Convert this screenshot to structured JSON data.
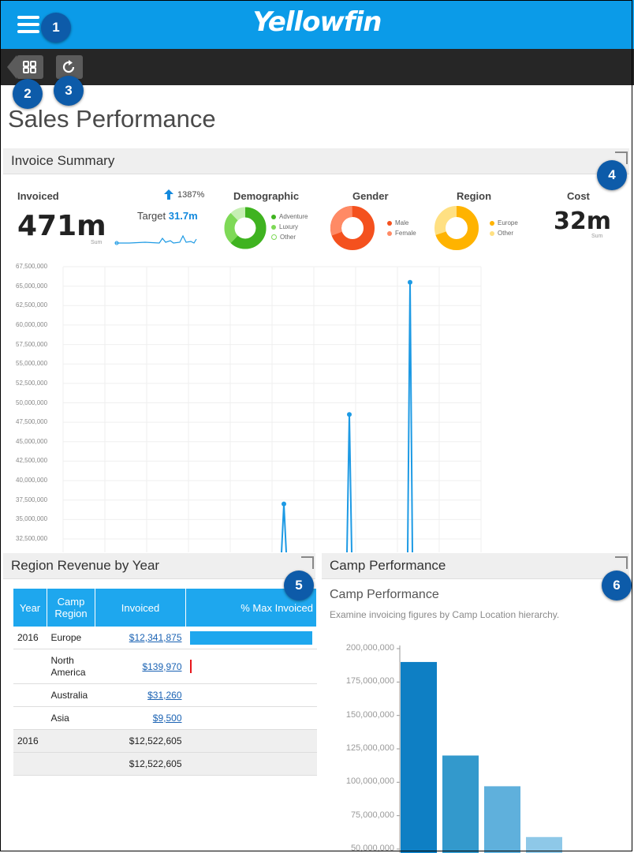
{
  "app": {
    "brand": "Yellowfin"
  },
  "page": {
    "title": "Sales Performance"
  },
  "badges": [
    "1",
    "2",
    "3",
    "4",
    "5",
    "6"
  ],
  "toolbar": {
    "grid_icon": "grid-icon",
    "refresh_icon": "refresh-icon"
  },
  "invoice_summary": {
    "header": "Invoice Summary",
    "invoiced": {
      "label": "Invoiced",
      "value": "471m",
      "sub": "Sum",
      "change": "1387%",
      "target_label": "Target",
      "target_value": "31.7m"
    },
    "demographic": {
      "label": "Demographic",
      "legend": [
        "Adventure",
        "Luxury",
        "Other"
      ],
      "colors": [
        "#3fb320",
        "#7ed957",
        "#c6efb3"
      ]
    },
    "gender": {
      "label": "Gender",
      "legend": [
        "Male",
        "Female"
      ],
      "colors": [
        "#f4511e",
        "#ff8a65"
      ]
    },
    "region": {
      "label": "Region",
      "legend": [
        "Europe",
        "Other"
      ],
      "colors": [
        "#ffb300",
        "#ffe082"
      ]
    },
    "cost": {
      "label": "Cost",
      "value": "32m",
      "sub": "Sum"
    }
  },
  "invoice_chart": {
    "y_ticks": [
      "67,500,000",
      "65,000,000",
      "62,500,000",
      "60,000,000",
      "57,500,000",
      "55,000,000",
      "52,500,000",
      "50,000,000",
      "47,500,000",
      "45,000,000",
      "42,500,000",
      "40,000,000",
      "37,500,000",
      "35,000,000",
      "32,500,000"
    ]
  },
  "chart_data": [
    {
      "type": "line",
      "ylim": [
        32500000,
        67500000
      ],
      "series": [
        {
          "values": [
            37000000,
            48500000,
            65500000
          ]
        }
      ],
      "grid": true
    },
    {
      "type": "bar",
      "title": "Camp Performance",
      "subtitle": "Examine invoicing figures by Camp Location hierarchy.",
      "y_ticks": [
        "200,000,000",
        "175,000,000",
        "150,000,000",
        "125,000,000",
        "100,000,000",
        "75,000,000",
        "50,000,000"
      ],
      "ylim": [
        50000000,
        200000000
      ],
      "values": [
        190000000,
        120000000,
        97000000,
        59000000
      ],
      "colors": [
        "#0e7fc4",
        "#3399cc",
        "#5fb0dc",
        "#8ec8e8"
      ]
    }
  ],
  "region_revenue": {
    "header": "Region Revenue by Year",
    "columns": [
      "Year",
      "Camp Region",
      "Invoiced",
      "% Max Invoiced"
    ],
    "rows": [
      {
        "year": "2016",
        "region": "Europe",
        "invoiced": "$12,341,875",
        "pct": 100
      },
      {
        "year": "",
        "region": "North America",
        "invoiced": "$139,970",
        "pct": 1
      },
      {
        "year": "",
        "region": "Australia",
        "invoiced": "$31,260",
        "pct": 0
      },
      {
        "year": "",
        "region": "Asia",
        "invoiced": "$9,500",
        "pct": 0
      }
    ],
    "totals": [
      {
        "year": "2016",
        "invoiced": "$12,522,605"
      },
      {
        "year": "",
        "invoiced": "$12,522,605"
      }
    ]
  },
  "camp_performance": {
    "header": "Camp Performance"
  }
}
